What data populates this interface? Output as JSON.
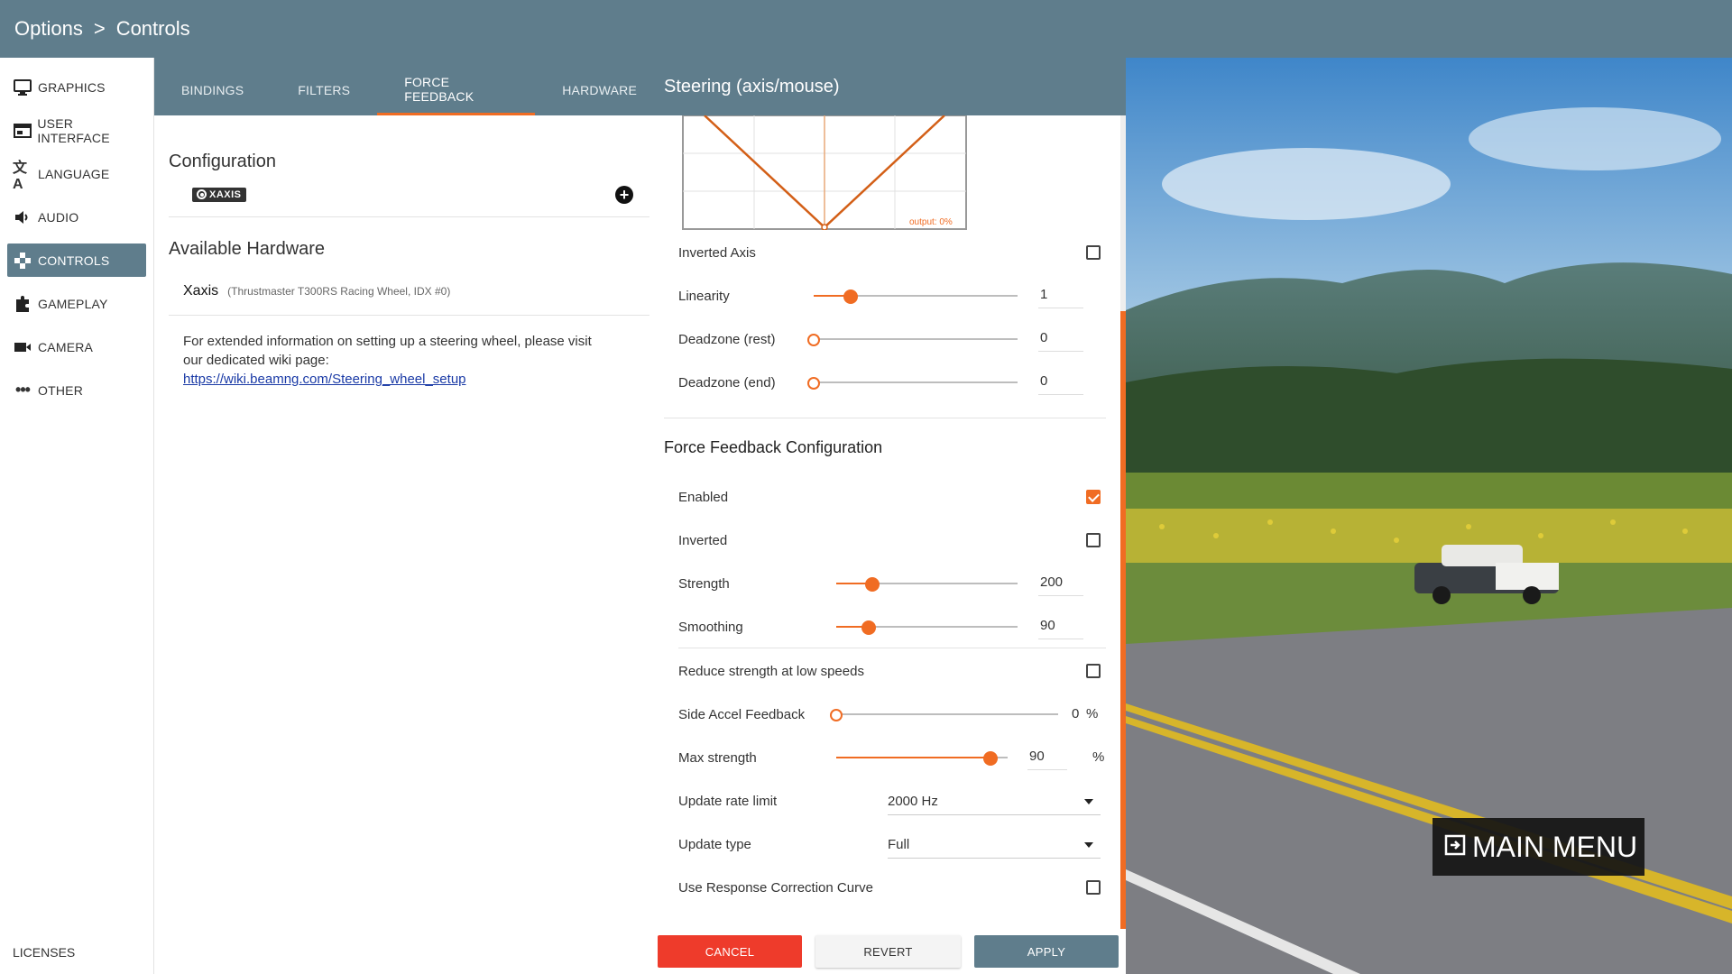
{
  "breadcrumb": {
    "root": "Options",
    "separator": ">",
    "current": "Controls"
  },
  "sidebar": {
    "items": [
      {
        "label": "GRAPHICS",
        "icon": "monitor-icon"
      },
      {
        "label": "USER INTERFACE",
        "icon": "window-icon"
      },
      {
        "label": "LANGUAGE",
        "icon": "translate-icon"
      },
      {
        "label": "AUDIO",
        "icon": "speaker-icon"
      },
      {
        "label": "CONTROLS",
        "icon": "gamepad-icon",
        "active": true
      },
      {
        "label": "GAMEPLAY",
        "icon": "puzzle-icon"
      },
      {
        "label": "CAMERA",
        "icon": "video-camera-icon"
      },
      {
        "label": "OTHER",
        "icon": "more-icon"
      }
    ],
    "licenses": "LICENSES"
  },
  "tabs": [
    {
      "label": "BINDINGS"
    },
    {
      "label": "FILTERS"
    },
    {
      "label": "FORCE FEEDBACK",
      "active": true
    },
    {
      "label": "HARDWARE"
    }
  ],
  "left": {
    "configuration_title": "Configuration",
    "config_chip": "XAXIS",
    "available_hardware_title": "Available Hardware",
    "hardware_name": "Xaxis",
    "hardware_desc": "(Thrustmaster T300RS Racing Wheel, IDX #0)",
    "info_text": "For extended information on setting up a steering wheel, please visit our dedicated wiki page:",
    "info_link": "https://wiki.beamng.com/Steering_wheel_setup"
  },
  "right": {
    "title": "Steering (axis/mouse)",
    "graph_output": "output: 0%",
    "inverted_axis": {
      "label": "Inverted Axis",
      "checked": false
    },
    "linearity": {
      "label": "Linearity",
      "value": "1",
      "fraction": 0.18
    },
    "deadzone_rest": {
      "label": "Deadzone (rest)",
      "value": "0",
      "fraction": 0
    },
    "deadzone_end": {
      "label": "Deadzone (end)",
      "value": "0",
      "fraction": 0
    },
    "ffb_title": "Force Feedback Configuration",
    "enabled": {
      "label": "Enabled",
      "checked": true
    },
    "inverted": {
      "label": "Inverted",
      "checked": false
    },
    "strength": {
      "label": "Strength",
      "value": "200",
      "fraction": 0.2
    },
    "smoothing": {
      "label": "Smoothing",
      "value": "90",
      "fraction": 0.18
    },
    "reduce_strength": {
      "label": "Reduce strength at low speeds",
      "checked": false
    },
    "side_accel": {
      "label": "Side Accel Feedback",
      "value": "0",
      "unit": "%",
      "fraction": 0
    },
    "max_strength": {
      "label": "Max strength",
      "value": "90",
      "unit": "%",
      "fraction": 0.9
    },
    "update_rate": {
      "label": "Update rate limit",
      "value": "2000 Hz"
    },
    "update_type": {
      "label": "Update type",
      "value": "Full"
    },
    "response_curve": {
      "label": "Use Response Correction Curve",
      "checked": false
    }
  },
  "buttons": {
    "cancel": "CANCEL",
    "revert": "REVERT",
    "apply": "APPLY"
  },
  "main_menu": "MAIN MENU",
  "colors": {
    "header": "#5f7d8c",
    "accent": "#f06c23",
    "cancel": "#ee3b2b"
  }
}
